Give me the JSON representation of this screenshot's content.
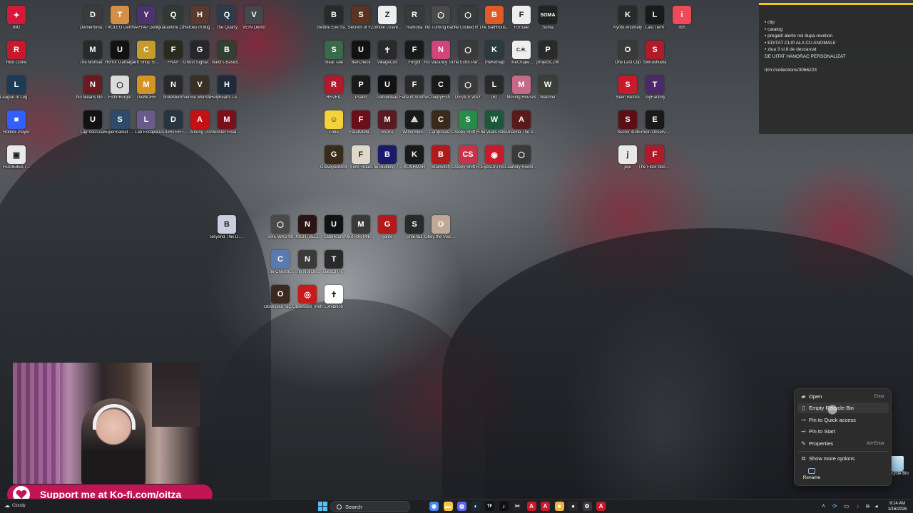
{
  "desktop": {
    "icons": [
      {
        "label": "Blitz",
        "abbr": "✦",
        "color": "#d6183a"
      },
      {
        "label": "Rick Clone",
        "abbr": "R",
        "color": "#c9182d"
      },
      {
        "label": "League of Legends",
        "abbr": "L",
        "color": "#1b3b57"
      },
      {
        "label": "Roblox Player",
        "abbr": "■",
        "color": "#335fff"
      },
      {
        "label": "F5A0E853-7...",
        "abbr": "▣",
        "color": "#e9e9e9"
      },
      {
        "label": "Dementoria...",
        "abbr": "D",
        "color": "#3b3b3b"
      },
      {
        "label": "TROLEU Demo",
        "abbr": "T",
        "color": "#d28f45"
      },
      {
        "label": "YAPYAP Demo",
        "abbr": "Y",
        "color": "#4d3270"
      },
      {
        "label": "Quarantine Zone The...",
        "abbr": "Q",
        "color": "#303a32"
      },
      {
        "label": "Heroes of Might and...",
        "abbr": "H",
        "color": "#5a3a2c"
      },
      {
        "label": "The Quarry",
        "abbr": "Q",
        "color": "#2d3b4a"
      },
      {
        "label": "VEIN Demo",
        "abbr": "V",
        "color": "#44484c"
      },
      {
        "label": "The Mortuar...",
        "abbr": "M",
        "color": "#2a2a2a"
      },
      {
        "label": "Horror Garbage",
        "abbr": "U",
        "color": "#121212"
      },
      {
        "label": "Card Shop Simulator",
        "abbr": "C",
        "color": "#c59b2c"
      },
      {
        "label": "FNAF",
        "abbr": "F",
        "color": "#2b2a1e"
      },
      {
        "label": "Ghost Signal: A Stell...",
        "abbr": "G",
        "color": "#28262a"
      },
      {
        "label": "Baldi's Basics...",
        "abbr": "B",
        "color": "#324032"
      },
      {
        "label": "No Means No Wayout",
        "abbr": "N",
        "color": "#6b1a22"
      },
      {
        "label": "FishnBurger",
        "abbr": "⬡",
        "color": "#dcdcdc"
      },
      {
        "label": "TheMORE",
        "abbr": "M",
        "color": "#d29521"
      },
      {
        "label": "NoteMoon",
        "abbr": "N",
        "color": "#2a2a2a"
      },
      {
        "label": "Venice Monster Hunt",
        "abbr": "V",
        "color": "#3a2f24"
      },
      {
        "label": "Holyhearts Legacy",
        "abbr": "H",
        "color": "#1f2a3a"
      },
      {
        "label": "Lay Vascular",
        "abbr": "U",
        "color": "#121212"
      },
      {
        "label": "Supermarket Simulator",
        "abbr": "S",
        "color": "#2f4a6a"
      },
      {
        "label": "Lab Escape",
        "abbr": "L",
        "color": "#6a5a8a"
      },
      {
        "label": "DAUGHTER ~ 0 Demo",
        "abbr": "D",
        "color": "#2a3340"
      },
      {
        "label": "Among Us",
        "abbr": "A",
        "color": "#c51111"
      },
      {
        "label": "Monster Final Night",
        "abbr": "M",
        "color": "#7a0f1a"
      },
      {
        "label": "Before Eve Supermarket",
        "abbr": "B",
        "color": "#2a2a2a"
      },
      {
        "label": "Secrets of F...",
        "abbr": "S",
        "color": "#5a3322"
      },
      {
        "label": "Zombie Graveyard",
        "abbr": "Z",
        "color": "#eeeeee"
      },
      {
        "label": "Ramona",
        "abbr": "R",
        "color": "#3a3a3a"
      },
      {
        "label": "No Turning Back",
        "abbr": "⬡",
        "color": "#4a4a4a"
      },
      {
        "label": "The Locked Room",
        "abbr": "⬡",
        "color": "#3a3a3a"
      },
      {
        "label": "The Bathhous...",
        "abbr": "B",
        "color": "#e05a2a"
      },
      {
        "label": "ForSale",
        "abbr": "F",
        "color": "#eeeeee"
      },
      {
        "label": "Soma",
        "abbr": "SOMA",
        "color": "#222222"
      },
      {
        "label": "Steal Tale",
        "abbr": "S",
        "color": "#3a6a4a"
      },
      {
        "label": "BellCheck",
        "abbr": "U",
        "color": "#121212"
      },
      {
        "label": "VillageCult",
        "abbr": "✝",
        "color": "#2a2a2a"
      },
      {
        "label": "Forgot",
        "abbr": "F",
        "color": "#1a1a1a"
      },
      {
        "label": "No Vacancy Tonight",
        "abbr": "N",
        "color": "#d0467a"
      },
      {
        "label": "The Echo Paradox",
        "abbr": "⬡",
        "color": "#3a3a3a"
      },
      {
        "label": "TheKidnap",
        "abbr": "K",
        "color": "#2a3a40"
      },
      {
        "label": "TheChape...",
        "abbr": "C.R.",
        "color": "#eeeeee"
      },
      {
        "label": "projectCZW",
        "abbr": "P",
        "color": "#2a2a2a"
      },
      {
        "label": "REVEIL",
        "abbr": "R",
        "color": "#b01a2a"
      },
      {
        "label": "Psalm",
        "abbr": "P",
        "color": "#1a1a1a"
      },
      {
        "label": "Gameldeas",
        "abbr": "U",
        "color": "#121212"
      },
      {
        "label": "Face of Another",
        "abbr": "F",
        "color": "#2a2a2a"
      },
      {
        "label": "CreepyFish...",
        "abbr": "C",
        "color": "#1a1a1a"
      },
      {
        "label": "DEVILS WAY",
        "abbr": "⬡",
        "color": "#3a3a3a"
      },
      {
        "label": "LBT",
        "abbr": "L",
        "color": "#2a2a2a"
      },
      {
        "label": "Moving Houses",
        "abbr": "M",
        "color": "#c66a8a"
      },
      {
        "label": "Watcher",
        "abbr": "W",
        "color": "#3a4038"
      },
      {
        "label": "Lobo",
        "abbr": "☺",
        "color": "#f3d23a"
      },
      {
        "label": "FatalMidni...",
        "abbr": "F",
        "color": "#6a0f1a"
      },
      {
        "label": "MARA",
        "abbr": "M",
        "color": "#5a1a22"
      },
      {
        "label": "WithinSkin...",
        "abbr": "⟁",
        "color": "#1a1a1a"
      },
      {
        "label": "CampGlas...",
        "abbr": "C",
        "color": "#3a2a1a"
      },
      {
        "label": "Creepy Shift House For...",
        "abbr": "S",
        "color": "#2a8a4a"
      },
      {
        "label": "The Walls Still Stand",
        "abbr": "W",
        "color": "#1a5a3a"
      },
      {
        "label": "Amanda The Adventurer 2",
        "abbr": "A",
        "color": "#5a1a1a"
      },
      {
        "label": "Graveyard404",
        "abbr": "G",
        "color": "#3a2a18"
      },
      {
        "label": "Fork_Road",
        "abbr": "F",
        "color": "#e0d8c8"
      },
      {
        "label": "The Building 71 Incident",
        "abbr": "B",
        "color": "#1a1a6a"
      },
      {
        "label": "KOSHMAR",
        "abbr": "K",
        "color": "#1a1a1a"
      },
      {
        "label": "Blairwitch",
        "abbr": "B",
        "color": "#b01a1a"
      },
      {
        "label": "Creepy Shift Roadside...",
        "abbr": "CS",
        "color": "#c8324a"
      },
      {
        "label": "EyesOnThe...",
        "abbr": "◉",
        "color": "#c81a2a"
      },
      {
        "label": "Laundry Room ...",
        "abbr": "⬡",
        "color": "#3a3a3a"
      },
      {
        "label": "Beyond This Death",
        "abbr": "B",
        "color": "#c8d0e0"
      },
      {
        "label": "SHE WAS 98",
        "abbr": "⬡",
        "color": "#4a4a4a"
      },
      {
        "label": "NIGHTBELL",
        "abbr": "N",
        "color": "#2a1414"
      },
      {
        "label": "LateHours",
        "abbr": "U",
        "color": "#121212"
      },
      {
        "label": "MIRROR MIRROR",
        "abbr": "M",
        "color": "#3a3a3a"
      },
      {
        "label": "game",
        "abbr": "G",
        "color": "#b01a1a"
      },
      {
        "label": "SnaPaul",
        "abbr": "S",
        "color": "#2a2a2a"
      },
      {
        "label": "Obey the Voice™",
        "abbr": "O",
        "color": "#c0a898"
      },
      {
        "label": "The Christm...",
        "abbr": "C",
        "color": "#5a7ab0"
      },
      {
        "label": "The Not De...",
        "abbr": "N",
        "color": "#3a3a3a"
      },
      {
        "label": "TalesOfTH...",
        "abbr": "T",
        "color": "#2a2a2a"
      },
      {
        "label": "Obsessed Night Shift",
        "abbr": "O",
        "color": "#3a2a22"
      },
      {
        "label": "Obsessed Theft",
        "abbr": "◎",
        "color": "#c81a1a"
      },
      {
        "label": "Exhibition",
        "abbr": "✝",
        "color": "#ffffff"
      },
      {
        "label": "Kyoto Anomaly",
        "abbr": "K",
        "color": "#2a2a2a"
      },
      {
        "label": "Last Term",
        "abbr": "L",
        "color": "#1a1a1a"
      },
      {
        "label": "itch",
        "abbr": "i",
        "color": "#f04a5a"
      },
      {
        "label": "One Last Clip",
        "abbr": "O",
        "color": "#3a3a3a"
      },
      {
        "label": "Sinnashiana",
        "abbr": "S",
        "color": "#b01a2a"
      },
      {
        "label": "Seen Before",
        "abbr": "S",
        "color": "#c81a2a"
      },
      {
        "label": "ToyFactory",
        "abbr": "T",
        "color": "#4a2a6a"
      },
      {
        "label": "Sector 404",
        "abbr": "S",
        "color": "#5a0f14"
      },
      {
        "label": "Emion Observat...",
        "abbr": "E",
        "color": "#1a1a1a"
      },
      {
        "label": "jeje",
        "abbr": "j",
        "color": "#e8e8e8"
      },
      {
        "label": "The Floor Above Demo",
        "abbr": "F",
        "color": "#b01a2a"
      }
    ]
  },
  "sticky_note": {
    "lines": [
      "• clip",
      "• catalog",
      "• pregatit alerte noi dupa revelion",
      "• EDITAT CLIP ALA CU ANOMALII",
      "• ziua 3 si 8 de descarcat",
      "DE UITAT HANORAC PERSONALIZAT"
    ],
    "link": "itch://collections/3066223",
    "accent": "#f3c419"
  },
  "kofi_banner": {
    "text": "Support me at Ko-fi.com/oitza",
    "color": "#c11554"
  },
  "context_menu": {
    "items": [
      {
        "label": "Open",
        "shortcut": "Enter",
        "icon": "folder-icon"
      },
      {
        "label": "Empty Recycle Bin",
        "shortcut": "",
        "icon": "empty-bin-icon"
      },
      {
        "label": "Pin to Quick access",
        "shortcut": "",
        "icon": "pin-icon"
      },
      {
        "label": "Pin to Start",
        "shortcut": "",
        "icon": "pin-icon"
      },
      {
        "label": "Properties",
        "shortcut": "Alt+Enter",
        "icon": "wrench-icon"
      },
      {
        "label": "Show more options",
        "shortcut": "",
        "icon": "more-options-icon"
      }
    ],
    "rename_label": "Rename"
  },
  "recycle_bin": {
    "label": "Recycle Bin"
  },
  "taskbar": {
    "weather": "Cloudy",
    "search_placeholder": "Search",
    "pinned_apps": [
      {
        "name": "chrome-icon",
        "color": "#4285f4",
        "glyph": "◉"
      },
      {
        "name": "file-explorer-icon",
        "color": "#f5c44a",
        "glyph": "▬"
      },
      {
        "name": "discord-icon",
        "color": "#5865f2",
        "glyph": "◍"
      },
      {
        "name": "steam-icon",
        "color": "#1b2838",
        "glyph": "◐"
      },
      {
        "name": "tiktok-studio-icon",
        "color": "#111111",
        "glyph": "TF"
      },
      {
        "name": "tiktok-icon",
        "color": "#111111",
        "glyph": "♪"
      },
      {
        "name": "capcut-icon",
        "color": "#222222",
        "glyph": "✂"
      },
      {
        "name": "app-red-icon",
        "color": "#c81a2a",
        "glyph": "A"
      },
      {
        "name": "app-red-2-icon",
        "color": "#c81a2a",
        "glyph": "A"
      },
      {
        "name": "app-yellow-icon",
        "color": "#e9b83a",
        "glyph": "■"
      },
      {
        "name": "app-dark-icon",
        "color": "#2a2a2a",
        "glyph": "●"
      },
      {
        "name": "app-settings-icon",
        "color": "#3a3a3a",
        "glyph": "⚙"
      },
      {
        "name": "app-red-3-icon",
        "color": "#c81a2a",
        "glyph": "A"
      }
    ],
    "clock_time": "9:14 AM",
    "clock_date": "1/16/2026"
  }
}
